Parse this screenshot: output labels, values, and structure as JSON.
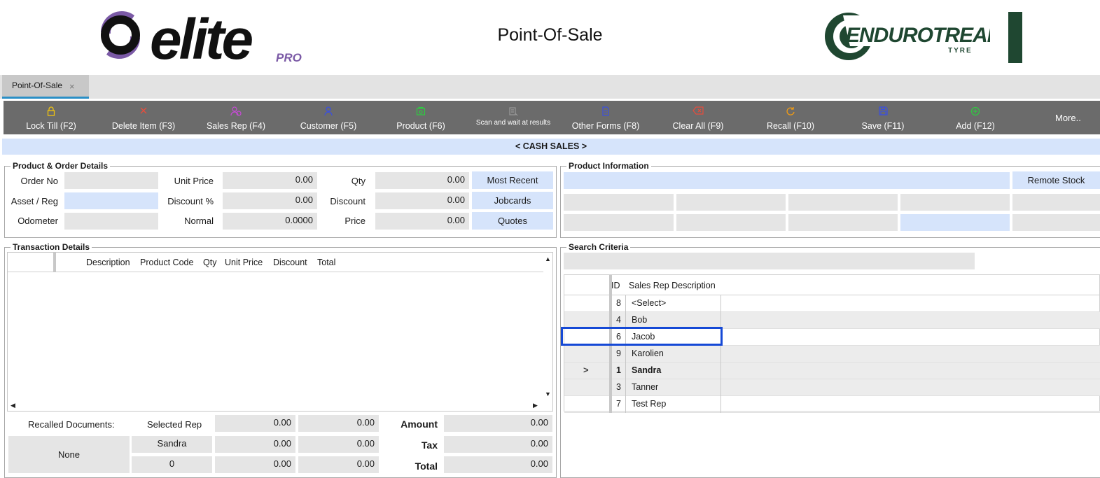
{
  "header": {
    "title": "Point-Of-Sale",
    "logo_left": {
      "text": "elite",
      "sub": "PRO"
    },
    "logo_right": {
      "text": "ENDUROTREAD",
      "sub": "TYRE"
    }
  },
  "tabs": [
    {
      "label": "Point-Of-Sale",
      "close": "×"
    }
  ],
  "toolbar": {
    "buttons": [
      {
        "label": "Lock Till (F2)",
        "icon": "lock-icon",
        "color": "#f1c40f"
      },
      {
        "label": "Delete Item (F3)",
        "icon": "delete-icon",
        "color": "#e74c3c"
      },
      {
        "label": "Sales Rep (F4)",
        "icon": "sales-rep-icon",
        "color": "#c74bd6"
      },
      {
        "label": "Customer (F5)",
        "icon": "customer-icon",
        "color": "#3b4fe0"
      },
      {
        "label": "Product (F6)",
        "icon": "product-icon",
        "color": "#2ecc40"
      },
      {
        "label": "Scan and wait at results",
        "icon": "scan-icon",
        "color": "#9a9a9a"
      },
      {
        "label": "Other Forms (F8)",
        "icon": "document-icon",
        "color": "#3b4fe0"
      },
      {
        "label": "Clear All (F9)",
        "icon": "clear-icon",
        "color": "#e74c3c"
      },
      {
        "label": "Recall (F10)",
        "icon": "recall-icon",
        "color": "#f39c12"
      },
      {
        "label": "Save (F11)",
        "icon": "save-icon",
        "color": "#3b4fe0"
      },
      {
        "label": "Add (F12)",
        "icon": "add-icon",
        "color": "#2ecc40"
      }
    ],
    "more": "More.."
  },
  "banner": "< CASH SALES >",
  "product_order": {
    "title": "Product & Order Details",
    "order_no_label": "Order No",
    "asset_reg_label": "Asset / Reg",
    "odometer_label": "Odometer",
    "unit_price_label": "Unit Price",
    "unit_price": "0.00",
    "discount_pct_label": "Discount %",
    "discount_pct": "0.00",
    "normal_label": "Normal",
    "normal": "0.0000",
    "qty_label": "Qty",
    "qty": "0.00",
    "discount_label": "Discount",
    "discount": "0.00",
    "price_label": "Price",
    "price": "0.00",
    "most_recent": "Most Recent",
    "jobcards": "Jobcards",
    "quotes": "Quotes"
  },
  "product_info": {
    "title": "Product Information",
    "remote_stock": "Remote Stock"
  },
  "transaction": {
    "title": "Transaction Details",
    "columns": [
      "Description",
      "Product Code",
      "Qty",
      "Unit Price",
      "Discount",
      "Total"
    ]
  },
  "summary": {
    "recalled_label": "Recalled Documents:",
    "recalled_value": "None",
    "selected_rep_label": "Selected Rep",
    "selected_rep": "Sandra",
    "rep_count": "0",
    "col1": [
      "0.00",
      "0.00",
      "0.00"
    ],
    "col2": [
      "0.00",
      "0.00",
      "0.00"
    ],
    "amount_label": "Amount",
    "amount": "0.00",
    "tax_label": "Tax",
    "tax": "0.00",
    "total_label": "Total",
    "total": "0.00"
  },
  "search": {
    "title": "Search Criteria",
    "columns": {
      "id": "ID",
      "desc": "Sales Rep Description"
    },
    "rows": [
      {
        "id": "8",
        "name": "<Select>"
      },
      {
        "id": "4",
        "name": "Bob"
      },
      {
        "id": "6",
        "name": "Jacob"
      },
      {
        "id": "9",
        "name": "Karolien"
      },
      {
        "id": "1",
        "name": "Sandra"
      },
      {
        "id": "3",
        "name": "Tanner"
      },
      {
        "id": "7",
        "name": "Test Rep"
      }
    ],
    "current_row_marker": ">"
  }
}
